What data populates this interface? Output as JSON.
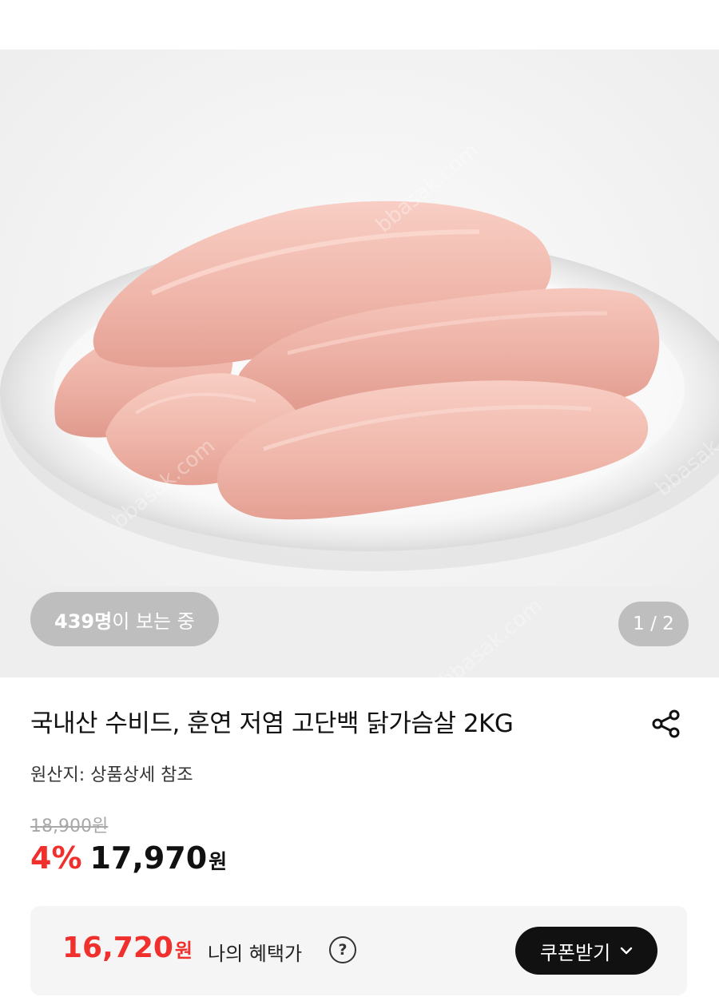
{
  "gallery": {
    "viewer_count": "439명",
    "viewer_suffix": "이 보는 중",
    "page_indicator": "1 / 2",
    "watermark": "bbasak.com"
  },
  "product": {
    "title": "국내산 수비드, 훈연 저염 고단백 닭가슴살 2KG",
    "origin": "원산지: 상품상세 참조",
    "original_price": "18,900원",
    "discount": "4%",
    "sale_price": "17,970",
    "sale_unit": "원"
  },
  "benefit": {
    "price": "16,720",
    "unit": "원",
    "label": "나의 혜택가",
    "help_glyph": "?",
    "coupon_button": "쿠폰받기"
  },
  "icons": {
    "share": "share-icon",
    "help": "question-circle-icon",
    "chevron": "chevron-down-icon"
  },
  "colors": {
    "accent": "#f0302c",
    "button": "#111111",
    "benefit_bg": "#f5f5f5"
  }
}
